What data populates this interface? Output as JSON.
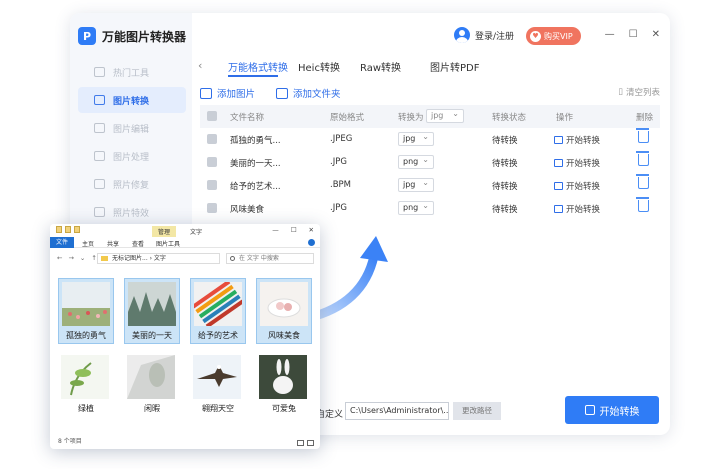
{
  "app": {
    "name": "万能图片转换器",
    "login": "登录/注册",
    "vip": "购买VIP",
    "controls": {
      "min": "—",
      "max": "☐",
      "close": "✕"
    }
  },
  "sidebar": {
    "items": [
      {
        "label": "热门工具"
      },
      {
        "label": "图片转换",
        "active": true
      },
      {
        "label": "图片编辑"
      },
      {
        "label": "图片处理"
      },
      {
        "label": "照片修复"
      },
      {
        "label": "照片特效"
      }
    ]
  },
  "tabs": [
    "万能格式转换",
    "Heic转换",
    "Raw转换",
    "图片转PDF"
  ],
  "toolbar": {
    "add_image": "添加图片",
    "add_folder": "添加文件夹",
    "clear": "清空列表"
  },
  "table": {
    "headers": {
      "name": "文件名称",
      "orig": "原始格式",
      "convert_to": "转换为",
      "convert_to_value": "jpg",
      "status": "转换状态",
      "op": "操作",
      "delete": "删除"
    },
    "rows": [
      {
        "name": "孤独的勇气...",
        "orig": ".JPEG",
        "target": "jpg",
        "status": "待转换",
        "op": "开始转换"
      },
      {
        "name": "美丽的一天...",
        "orig": ".JPG",
        "target": "png",
        "status": "待转换",
        "op": "开始转换"
      },
      {
        "name": "给予的艺术...",
        "orig": ".BPM",
        "target": "jpg",
        "status": "待转换",
        "op": "开始转换"
      },
      {
        "name": "风味美食",
        "orig": ".JPG",
        "target": "png",
        "status": "待转换",
        "op": "开始转换"
      }
    ]
  },
  "bottom": {
    "path_label": "自定义",
    "path_value": "C:\\Users\\Administrator\\...",
    "change_path": "更改路径",
    "start": "开始转换"
  },
  "explorer": {
    "manage": "管理",
    "title": "文字",
    "ribbon": [
      "文件",
      "主页",
      "共享",
      "查看",
      "图片工具"
    ],
    "nav": [
      "←",
      "→",
      "⌄",
      "↑"
    ],
    "address": "无标记图片... › 文字",
    "search_placeholder": "在 文字 中搜索",
    "status": "8 个项目",
    "items": [
      {
        "caption": "孤独的勇气",
        "selected": true
      },
      {
        "caption": "美丽的一天",
        "selected": true
      },
      {
        "caption": "给予的艺术",
        "selected": true
      },
      {
        "caption": "风味美食",
        "selected": true
      },
      {
        "caption": "绿植"
      },
      {
        "caption": "闲暇"
      },
      {
        "caption": "翱翔天空"
      },
      {
        "caption": "可爱兔"
      }
    ]
  },
  "colors": {
    "accent": "#2f7cf6",
    "vip": "#f0745f",
    "selection": "#cce4f7"
  }
}
